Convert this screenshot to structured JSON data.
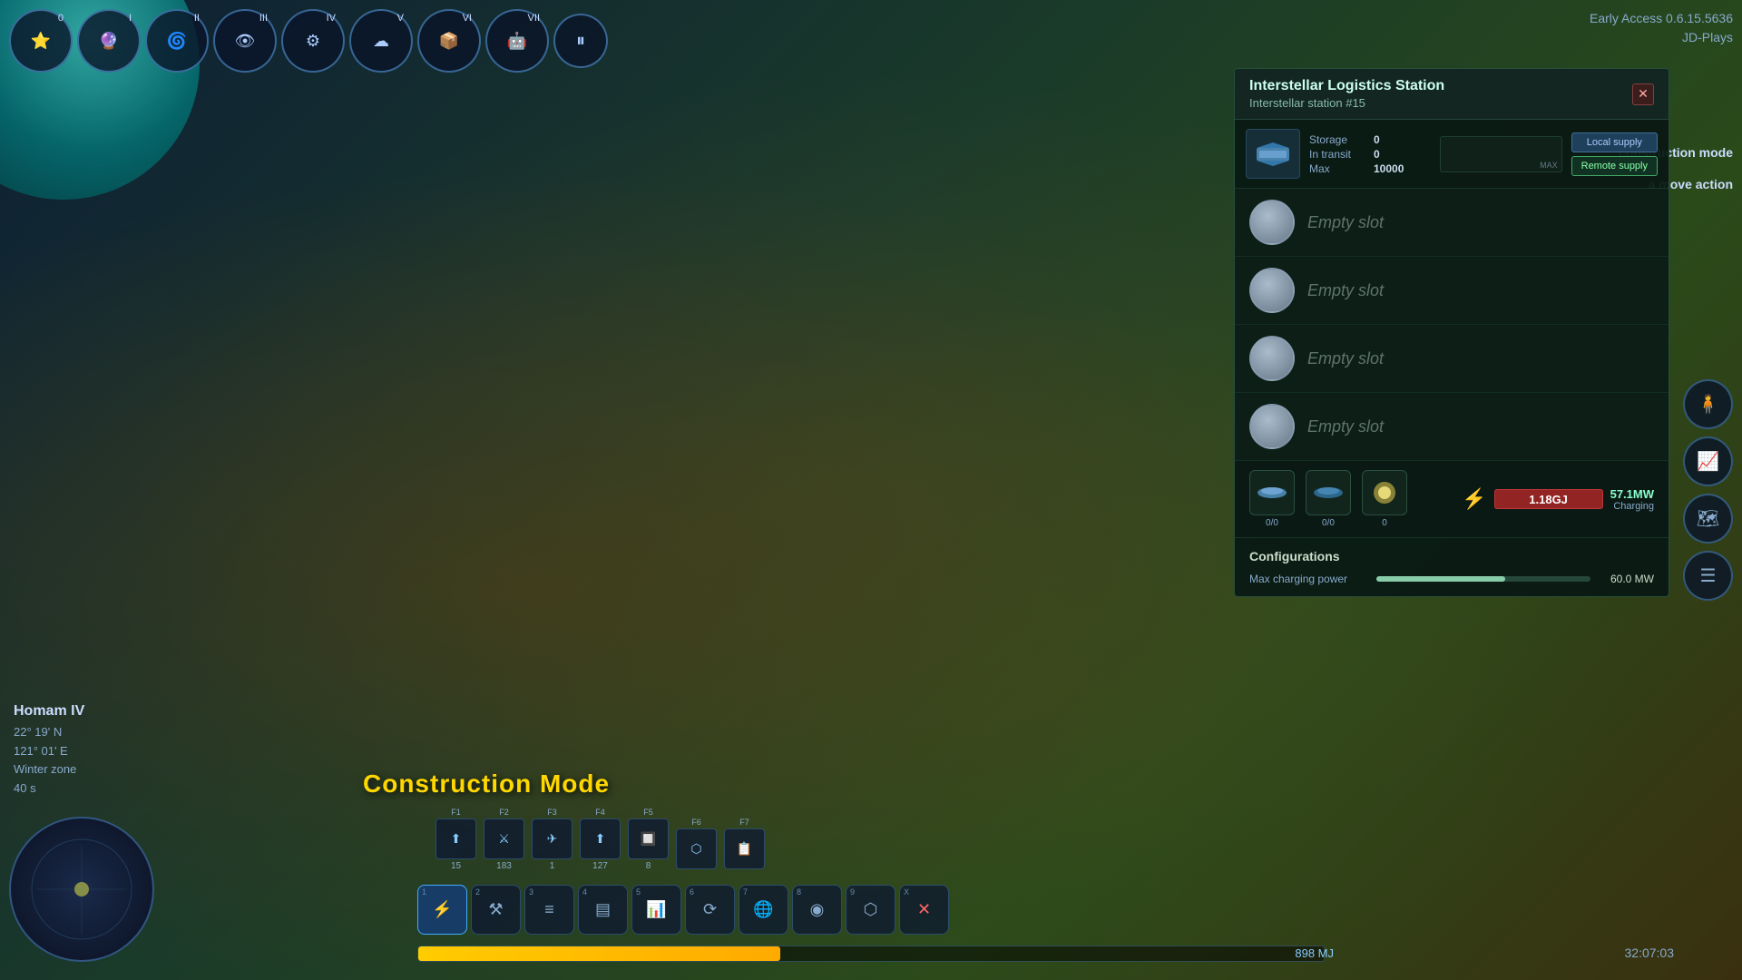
{
  "version": {
    "text": "Early Access 0.6.15.5636",
    "player": "JD-Plays"
  },
  "time": "32:07:03",
  "location": {
    "name": "Homam IV",
    "coords": "22° 19' N\n121° 01' E",
    "season": "Winter zone",
    "timer": "40 s"
  },
  "panel": {
    "title": "Interstellar Logistics Station",
    "subtitle": "Interstellar station #15",
    "close_label": "✕"
  },
  "storage": {
    "label": "Storage",
    "in_transit_label": "In transit",
    "max_label": "Max",
    "storage_value": "0",
    "in_transit_value": "0",
    "max_value": "10000",
    "max_bar_label": "MAX"
  },
  "supply_buttons": {
    "local": "Local supply",
    "remote": "Remote supply"
  },
  "slots": [
    {
      "label": "Empty slot"
    },
    {
      "label": "Empty slot"
    },
    {
      "label": "Empty slot"
    },
    {
      "label": "Empty slot"
    }
  ],
  "resources": [
    {
      "icon": "🚀",
      "count": "0/0"
    },
    {
      "icon": "🛸",
      "count": "0/0"
    },
    {
      "icon": "✨",
      "count": "0"
    }
  ],
  "energy": {
    "value": "1.18GJ",
    "mw_value": "57.1MW",
    "mw_label": "Charging"
  },
  "configurations": {
    "title": "Configurations",
    "max_charging_label": "Max charging power",
    "max_charging_value": "60.0 MW"
  },
  "construction_mode": "Construction Mode",
  "toolbar": {
    "items": [
      {
        "badge": "0",
        "icon": "⭐"
      },
      {
        "badge": "1",
        "icon": "🔮"
      },
      {
        "badge": "2",
        "icon": "🌀"
      },
      {
        "badge": "3",
        "icon": "👁"
      },
      {
        "badge": "4",
        "icon": "⚙"
      },
      {
        "badge": "5",
        "icon": "☁"
      },
      {
        "badge": "6",
        "icon": "📦"
      },
      {
        "badge": "7",
        "icon": "🤖"
      }
    ],
    "pause": "⏸"
  },
  "f_buttons": [
    {
      "key": "F1",
      "count": "15"
    },
    {
      "key": "F2",
      "count": "183"
    },
    {
      "key": "F3",
      "count": "1"
    },
    {
      "key": "F4",
      "count": "127"
    },
    {
      "key": "F5",
      "count": "8"
    },
    {
      "key": "F6",
      "count": ""
    },
    {
      "key": "F7",
      "count": ""
    }
  ],
  "bottom_tools": [
    {
      "icon": "⚡",
      "num": "1"
    },
    {
      "icon": "⚒",
      "num": "2"
    },
    {
      "icon": "≡",
      "num": "3"
    },
    {
      "icon": "▤",
      "num": "4"
    },
    {
      "icon": "📊",
      "num": "5"
    },
    {
      "icon": "⟳",
      "num": "6"
    },
    {
      "icon": "🌐",
      "num": "7"
    },
    {
      "icon": "◉",
      "num": "8"
    },
    {
      "icon": "⬡",
      "num": "9"
    },
    {
      "icon": "✕",
      "num": "X"
    }
  ],
  "energy_bar": {
    "value": "898 MJ"
  },
  "side_labels": {
    "construction_mode": "construction mode",
    "move_action": "a move action"
  }
}
